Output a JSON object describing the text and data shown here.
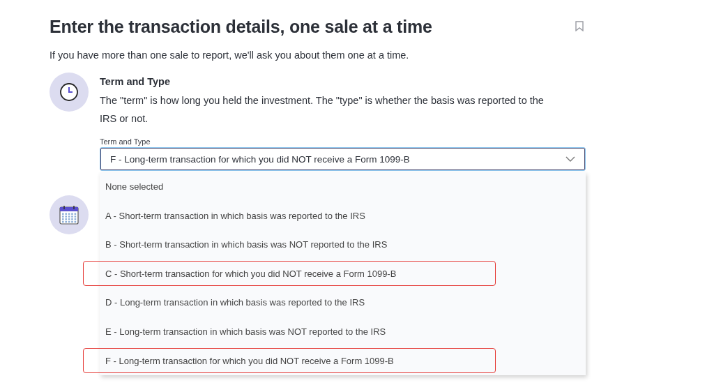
{
  "title": "Enter the transaction details, one sale at a time",
  "subtitle": "If you have more than one sale to report, we'll ask you about them one at a time.",
  "section": {
    "heading": "Term and Type",
    "description": "The \"term\" is how long you held the investment. The \"type\" is whether the basis was reported to the IRS or not.",
    "field_label": "Term and Type",
    "value": "F - Long-term transaction for which you did NOT receive a Form 1099-B",
    "expanded": true,
    "options": [
      {
        "label": "None selected",
        "highlighted": false
      },
      {
        "label": "A - Short-term transaction in which basis was reported to the IRS",
        "highlighted": false
      },
      {
        "label": "B - Short-term transaction in which basis was NOT reported to the IRS",
        "highlighted": false
      },
      {
        "label": "C - Short-term transaction for which you did NOT receive a Form 1099-B",
        "highlighted": true
      },
      {
        "label": "D - Long-term transaction in which basis was reported to the IRS",
        "highlighted": false
      },
      {
        "label": "E - Long-term transaction in which basis was NOT reported to the IRS",
        "highlighted": false
      },
      {
        "label": "F - Long-term transaction for which you did NOT receive a Form 1099-B",
        "highlighted": true
      }
    ]
  }
}
